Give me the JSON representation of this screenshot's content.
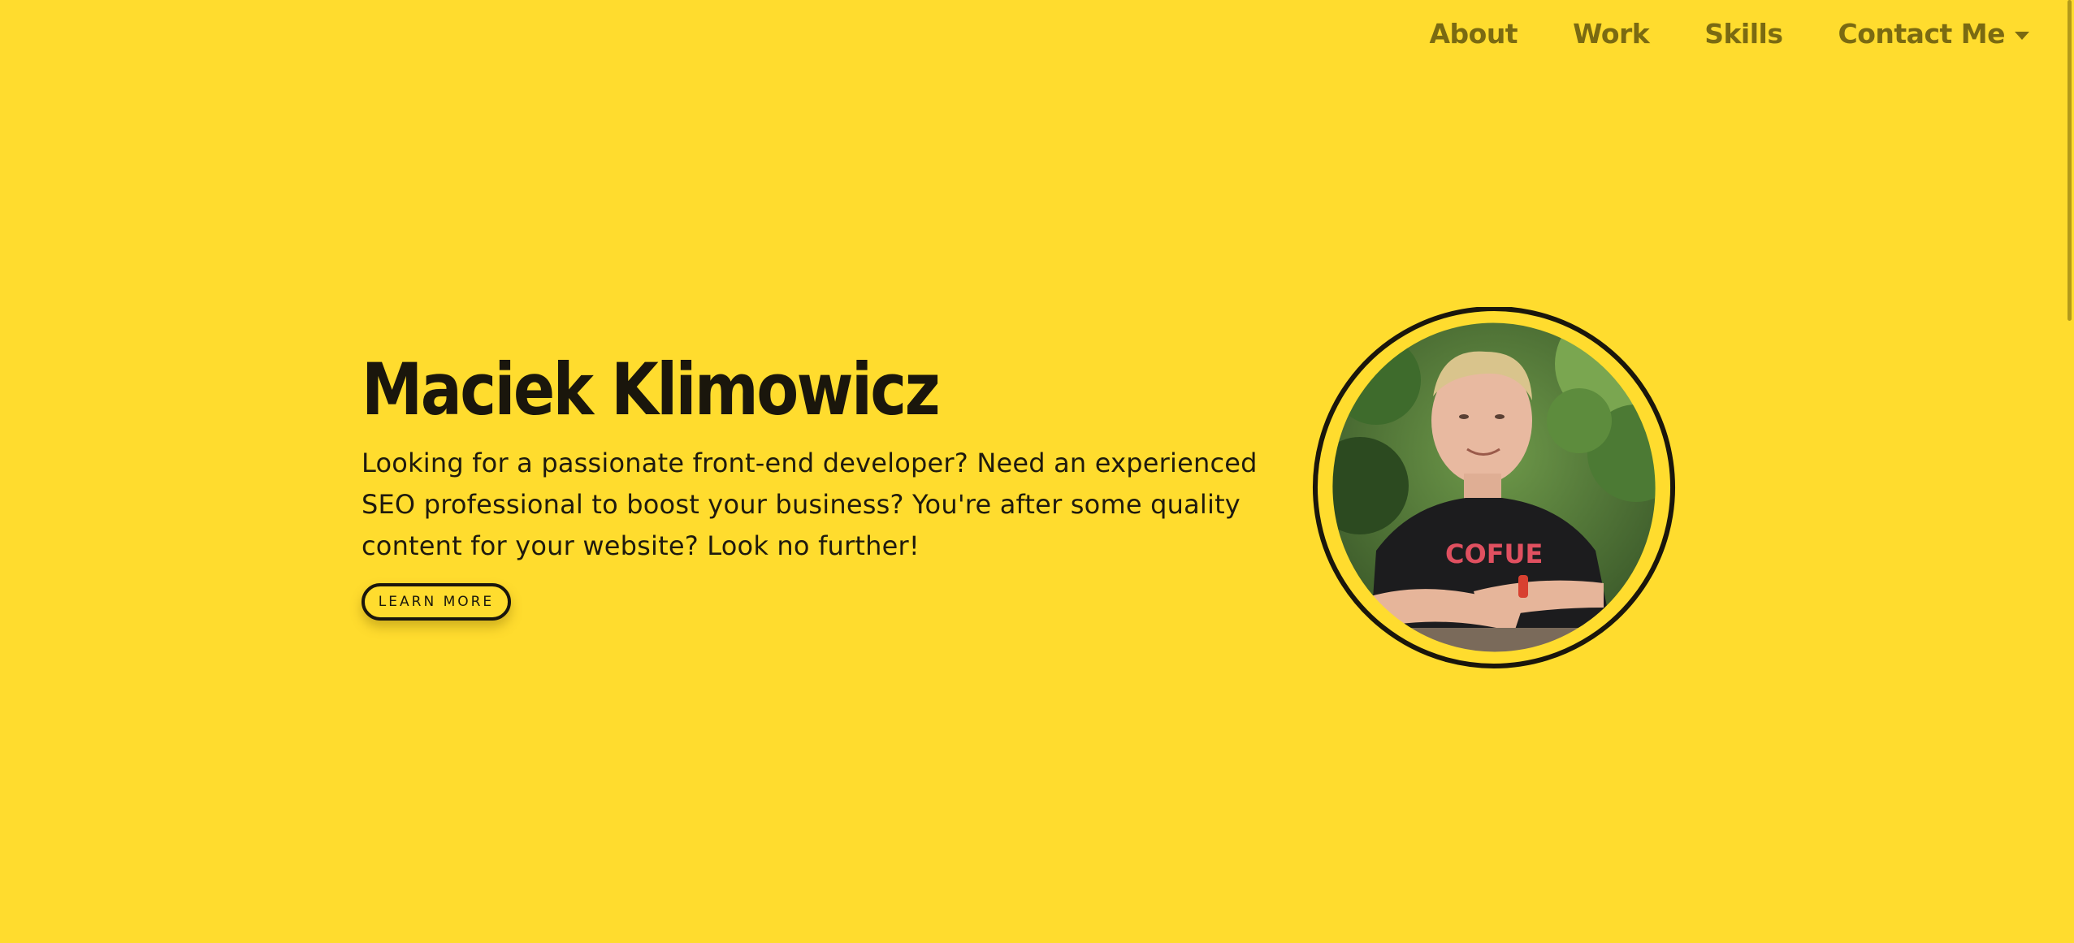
{
  "nav": {
    "items": [
      {
        "label": "About"
      },
      {
        "label": "Work"
      },
      {
        "label": "Skills"
      },
      {
        "label": "Contact Me"
      }
    ]
  },
  "hero": {
    "name": "Maciek Klimowicz",
    "description": "Looking for a passionate front-end developer? Need an experienced SEO professional to boost your business? You're after some quality content for your website? Look no further!",
    "button_label": "LEARN MORE"
  },
  "avatar": {
    "shirt_text": "COFUE"
  },
  "colors": {
    "background": "#FFDC2E",
    "nav_text": "#7a6a12",
    "text": "#1a160c"
  }
}
